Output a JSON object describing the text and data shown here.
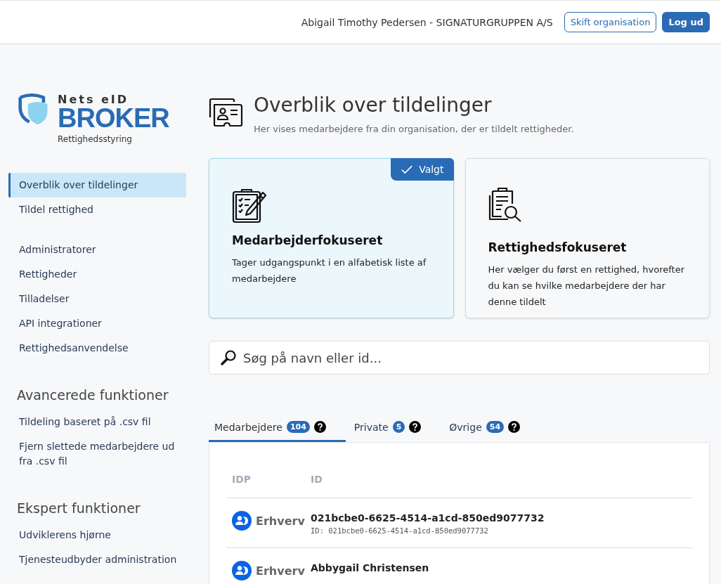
{
  "header": {
    "user": "Abigail Timothy Pedersen - SIGNATURGRUPPEN A/S",
    "buttons": [
      {
        "label": "Skift organisation",
        "kind": "outline"
      },
      {
        "label": "Log ud",
        "kind": "solid"
      }
    ]
  },
  "logo": {
    "top": "Nets eID",
    "main": "BROKER",
    "subtitle": "Rettighedsstyring"
  },
  "sidebar": {
    "groups": [
      {
        "items": [
          {
            "label": "Overblik over tildelinger",
            "selected": true
          },
          {
            "label": "Tildel rettighed",
            "selected": false
          }
        ]
      },
      {
        "items": [
          {
            "label": "Administratorer",
            "selected": false
          },
          {
            "label": "Rettigheder",
            "selected": false
          },
          {
            "label": "Tilladelser",
            "selected": false
          },
          {
            "label": "API integrationer",
            "selected": false
          },
          {
            "label": "Rettighedsanvendelse",
            "selected": false
          }
        ]
      },
      {
        "heading": "Avancerede funktioner",
        "items": [
          {
            "label": "Tildeling baseret på .csv fil",
            "selected": false
          },
          {
            "label": "Fjern slettede medarbejdere ud fra .csv fil",
            "selected": false
          }
        ]
      },
      {
        "heading": "Ekspert funktioner",
        "items": [
          {
            "label": "Udviklerens hjørne",
            "selected": false
          },
          {
            "label": "Tjenesteudbyder administration",
            "selected": false
          }
        ]
      }
    ]
  },
  "page": {
    "title": "Overblik over tildelinger",
    "subtitle": "Her vises medarbejdere fra din organisation, der er tildelt rettigheder."
  },
  "cards": [
    {
      "kind": "clipboard-pen",
      "title": "Medarbejderfokuseret",
      "description": "Tager udgangspunkt i en alfabetisk liste af medarbejdere",
      "selected": true,
      "badge": "Valgt"
    },
    {
      "kind": "clipboard-search",
      "title": "Rettighedsfokuseret",
      "description": "Her vælger du først en rettighed, hvorefter du kan se hvilke medarbejdere der har denne tildelt",
      "selected": false
    }
  ],
  "search": {
    "placeholder": "Søg på navn eller id..."
  },
  "tabs": [
    {
      "label": "Medarbejdere",
      "count": "104",
      "selected": true
    },
    {
      "label": "Private",
      "count": "5",
      "selected": false
    },
    {
      "label": "Øvrige",
      "count": "54",
      "selected": false
    }
  ],
  "table": {
    "columns": [
      "IDP",
      "ID"
    ],
    "rows": [
      {
        "idp": "Erhverv",
        "name": "021bcbe0-6625-4514-a1cd-850ed9077732",
        "id_line": "ID: 021bcbe0-6625-4514-a1cd-850ed9077732"
      },
      {
        "idp": "Erhverv",
        "name": "Abbygail Christensen"
      }
    ]
  }
}
